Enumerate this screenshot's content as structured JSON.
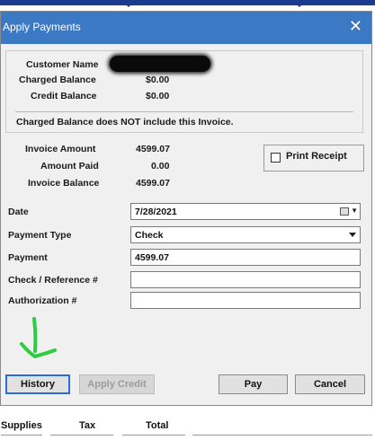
{
  "window": {
    "title": "Apply Payments",
    "close_glyph": "✕"
  },
  "customer": {
    "name_label": "Customer Name",
    "charged_balance_label": "Charged Balance",
    "charged_balance": "$0.00",
    "credit_balance_label": "Credit Balance",
    "credit_balance": "$0.00",
    "note": "Charged Balance does NOT include this Invoice."
  },
  "invoice": {
    "amount_label": "Invoice Amount",
    "amount": "4599.07",
    "paid_label": "Amount Paid",
    "paid": "0.00",
    "balance_label": "Invoice Balance",
    "balance": "4599.07"
  },
  "print_receipt": {
    "label": "Print Receipt",
    "checked": false
  },
  "form": {
    "date_label": "Date",
    "date_value": "7/28/2021",
    "payment_type_label": "Payment Type",
    "payment_type_value": "Check",
    "payment_label": "Payment",
    "payment_value": "4599.07",
    "check_ref_label": "Check / Reference #",
    "check_ref_value": "",
    "auth_label": "Authorization #",
    "auth_value": ""
  },
  "buttons": {
    "history": "History",
    "apply_credit": "Apply Credit",
    "pay": "Pay",
    "cancel": "Cancel"
  },
  "footer": {
    "col1": "Supplies",
    "col2": "Tax",
    "col3": "Total"
  },
  "colors": {
    "titlebar": "#3c79c5",
    "annotation_arrow": "#2ecc40"
  },
  "icons": [
    "close-icon",
    "calendar-icon",
    "dropdown-arrow-icon",
    "annotation-arrow-icon"
  ]
}
